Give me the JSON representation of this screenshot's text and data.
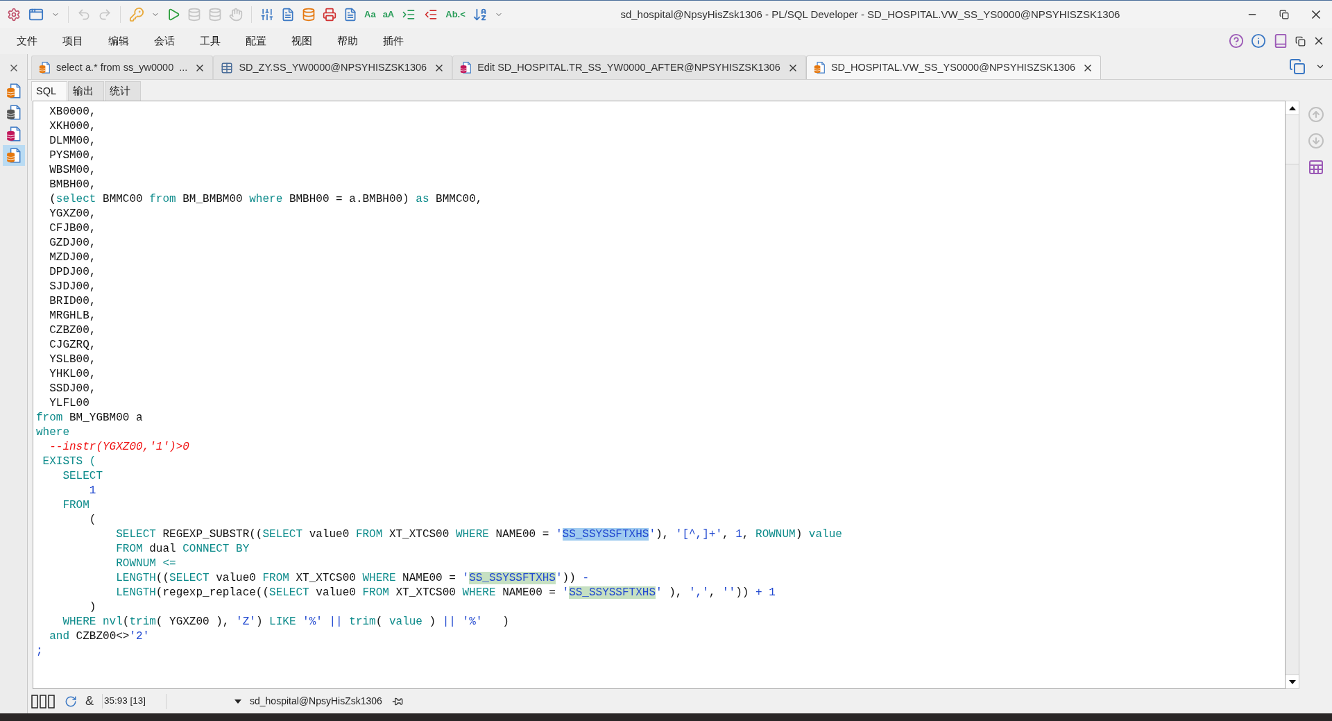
{
  "window": {
    "title": "sd_hospital@NpsyHisZsk1306 - PL/SQL Developer - SD_HOSPITAL.VW_SS_YS0000@NPSYHISZSK1306"
  },
  "toolbar": [
    {
      "kind": "icon",
      "disabled": false
    },
    {
      "kind": "icon",
      "disabled": false
    },
    {
      "kind": "icon",
      "disabled": false
    },
    {
      "kind": "icon",
      "disabled": true
    },
    {
      "kind": "icon",
      "disabled": true
    },
    {
      "kind": "icon",
      "disabled": false
    },
    {
      "kind": "icon",
      "disabled": false
    },
    {
      "kind": "icon",
      "disabled": false
    },
    {
      "kind": "icon",
      "disabled": true
    },
    {
      "kind": "icon",
      "disabled": true
    },
    {
      "kind": "icon",
      "disabled": true
    },
    {
      "kind": "icon",
      "disabled": false
    },
    {
      "kind": "icon",
      "disabled": false
    },
    {
      "kind": "icon",
      "disabled": false
    },
    {
      "kind": "icon",
      "disabled": false
    },
    {
      "kind": "icon",
      "disabled": false
    },
    {
      "kind": "glyph",
      "label": "Aa",
      "disabled": false
    },
    {
      "kind": "glyph",
      "label": "aA",
      "disabled": false
    },
    {
      "kind": "icon",
      "disabled": false
    },
    {
      "kind": "icon",
      "disabled": false
    },
    {
      "kind": "glyph",
      "label": "Ab.<",
      "disabled": false
    },
    {
      "kind": "icon",
      "disabled": false
    },
    {
      "kind": "icon",
      "disabled": false
    }
  ],
  "menu": [
    "文件",
    "项目",
    "编辑",
    "会话",
    "工具",
    "配置",
    "视图",
    "帮助",
    "插件"
  ],
  "windows": [
    {
      "kind": "sql",
      "selected": false
    },
    {
      "kind": "table",
      "selected": false
    },
    {
      "kind": "edit",
      "selected": false
    },
    {
      "kind": "sql",
      "selected": true
    }
  ],
  "tabs": [
    {
      "kind": "sql",
      "label": "select a.* from ss_yw0000  ...",
      "selected": false
    },
    {
      "kind": "table",
      "label": "SD_ZY.SS_YW0000@NPSYHISZSK1306",
      "selected": false
    },
    {
      "kind": "edit",
      "label": "Edit SD_HOSPITAL.TR_SS_YW0000_AFTER@NPSYHISZSK1306",
      "selected": false
    },
    {
      "kind": "sql",
      "label": "SD_HOSPITAL.VW_SS_YS0000@NPSYHISZSK1306",
      "selected": true
    }
  ],
  "sub_tabs": [
    {
      "label": "SQL",
      "selected": true
    },
    {
      "label": "输出",
      "selected": false
    },
    {
      "label": "统计",
      "selected": false
    }
  ],
  "code": [
    {
      "tokens": [
        {
          "kind": "plain",
          "text": "  XB0000,"
        }
      ]
    },
    {
      "tokens": [
        {
          "kind": "plain",
          "text": "  XKH000,"
        }
      ]
    },
    {
      "tokens": [
        {
          "kind": "plain",
          "text": "  DLMM00,"
        }
      ]
    },
    {
      "tokens": [
        {
          "kind": "plain",
          "text": "  PYSM00,"
        }
      ]
    },
    {
      "tokens": [
        {
          "kind": "plain",
          "text": "  WBSM00,"
        }
      ]
    },
    {
      "tokens": [
        {
          "kind": "plain",
          "text": "  BMBH00,"
        }
      ]
    },
    {
      "tokens": [
        {
          "kind": "plain",
          "text": "  ("
        },
        {
          "kind": "kw",
          "text": "select"
        },
        {
          "kind": "plain",
          "text": " BMMC00 "
        },
        {
          "kind": "kw",
          "text": "from"
        },
        {
          "kind": "plain",
          "text": " BM_BMBM00 "
        },
        {
          "kind": "kw",
          "text": "where"
        },
        {
          "kind": "plain",
          "text": " BMBH00 = a.BMBH00) "
        },
        {
          "kind": "kw",
          "text": "as"
        },
        {
          "kind": "plain",
          "text": " BMMC00,"
        }
      ]
    },
    {
      "tokens": [
        {
          "kind": "plain",
          "text": "  YGXZ00,"
        }
      ]
    },
    {
      "tokens": [
        {
          "kind": "plain",
          "text": "  CFJB00,"
        }
      ]
    },
    {
      "tokens": [
        {
          "kind": "plain",
          "text": "  GZDJ00,"
        }
      ]
    },
    {
      "tokens": [
        {
          "kind": "plain",
          "text": "  MZDJ00,"
        }
      ]
    },
    {
      "tokens": [
        {
          "kind": "plain",
          "text": "  DPDJ00,"
        }
      ]
    },
    {
      "tokens": [
        {
          "kind": "plain",
          "text": "  SJDJ00,"
        }
      ]
    },
    {
      "tokens": [
        {
          "kind": "plain",
          "text": "  BRID00,"
        }
      ]
    },
    {
      "tokens": [
        {
          "kind": "plain",
          "text": "  MRGHLB,"
        }
      ]
    },
    {
      "tokens": [
        {
          "kind": "plain",
          "text": "  CZBZ00,"
        }
      ]
    },
    {
      "tokens": [
        {
          "kind": "plain",
          "text": "  CJGZRQ,"
        }
      ]
    },
    {
      "tokens": [
        {
          "kind": "plain",
          "text": "  YSLB00,"
        }
      ]
    },
    {
      "tokens": [
        {
          "kind": "plain",
          "text": "  YHKL00,"
        }
      ]
    },
    {
      "tokens": [
        {
          "kind": "plain",
          "text": "  SSDJ00,"
        }
      ]
    },
    {
      "tokens": [
        {
          "kind": "plain",
          "text": "  YLFL00"
        }
      ]
    },
    {
      "tokens": [
        {
          "kind": "kw",
          "text": "from"
        },
        {
          "kind": "plain",
          "text": " BM_YGBM00 a"
        }
      ]
    },
    {
      "tokens": [
        {
          "kind": "kw",
          "text": "where"
        }
      ]
    },
    {
      "tokens": [
        {
          "kind": "comment",
          "text": "  --instr(YGXZ00,'1')>0"
        }
      ]
    },
    {
      "tokens": [
        {
          "kind": "kw",
          "text": " EXISTS ("
        }
      ]
    },
    {
      "tokens": [
        {
          "kind": "kw",
          "text": "    SELECT"
        }
      ]
    },
    {
      "tokens": [
        {
          "kind": "num",
          "text": "        1"
        }
      ]
    },
    {
      "tokens": [
        {
          "kind": "kw",
          "text": "    FROM"
        }
      ]
    },
    {
      "tokens": [
        {
          "kind": "plain",
          "text": "        ("
        }
      ]
    },
    {
      "tokens": [
        {
          "kind": "kw",
          "text": "            SELECT"
        },
        {
          "kind": "plain",
          "text": " REGEXP_SUBSTR(("
        },
        {
          "kind": "kw",
          "text": "SELECT"
        },
        {
          "kind": "plain",
          "text": " value0 "
        },
        {
          "kind": "kw",
          "text": "FROM"
        },
        {
          "kind": "plain",
          "text": " XT_XTCS00 "
        },
        {
          "kind": "kw",
          "text": "WHERE"
        },
        {
          "kind": "plain",
          "text": " NAME00 = "
        },
        {
          "kind": "str",
          "text": "'"
        },
        {
          "kind": "sel",
          "text": "SS_SSYSSFTXHS"
        },
        {
          "kind": "str",
          "text": "'"
        },
        {
          "kind": "plain",
          "text": "), "
        },
        {
          "kind": "str",
          "text": "'[^,]+'"
        },
        {
          "kind": "plain",
          "text": ", "
        },
        {
          "kind": "num",
          "text": "1"
        },
        {
          "kind": "plain",
          "text": ", "
        },
        {
          "kind": "kw",
          "text": "ROWNUM"
        },
        {
          "kind": "plain",
          "text": ") "
        },
        {
          "kind": "kw",
          "text": "value"
        }
      ]
    },
    {
      "tokens": [
        {
          "kind": "kw",
          "text": "            FROM"
        },
        {
          "kind": "plain",
          "text": " dual "
        },
        {
          "kind": "kw",
          "text": "CONNECT BY"
        }
      ]
    },
    {
      "tokens": [
        {
          "kind": "kw",
          "text": "            ROWNUM <="
        }
      ]
    },
    {
      "tokens": [
        {
          "kind": "kw",
          "text": "            LENGTH"
        },
        {
          "kind": "plain",
          "text": "(("
        },
        {
          "kind": "kw",
          "text": "SELECT"
        },
        {
          "kind": "plain",
          "text": " value0 "
        },
        {
          "kind": "kw",
          "text": "FROM"
        },
        {
          "kind": "plain",
          "text": " XT_XTCS00 "
        },
        {
          "kind": "kw",
          "text": "WHERE"
        },
        {
          "kind": "plain",
          "text": " NAME00 = "
        },
        {
          "kind": "str",
          "text": "'"
        },
        {
          "kind": "match",
          "text": "SS_SSYSSFTXHS"
        },
        {
          "kind": "str",
          "text": "'"
        },
        {
          "kind": "plain",
          "text": ")) "
        },
        {
          "kind": "op",
          "text": "-"
        }
      ]
    },
    {
      "tokens": [
        {
          "kind": "kw",
          "text": "            LENGTH"
        },
        {
          "kind": "plain",
          "text": "(regexp_replace(("
        },
        {
          "kind": "kw",
          "text": "SELECT"
        },
        {
          "kind": "plain",
          "text": " value0 "
        },
        {
          "kind": "kw",
          "text": "FROM"
        },
        {
          "kind": "plain",
          "text": " XT_XTCS00 "
        },
        {
          "kind": "kw",
          "text": "WHERE"
        },
        {
          "kind": "plain",
          "text": " NAME00 = "
        },
        {
          "kind": "str",
          "text": "'"
        },
        {
          "kind": "match",
          "text": "SS_SSYSSFTXHS"
        },
        {
          "kind": "str",
          "text": "'"
        },
        {
          "kind": "plain",
          "text": " ), "
        },
        {
          "kind": "str",
          "text": "','"
        },
        {
          "kind": "plain",
          "text": ", "
        },
        {
          "kind": "str",
          "text": "''"
        },
        {
          "kind": "plain",
          "text": ")) "
        },
        {
          "kind": "op",
          "text": "+ 1"
        }
      ]
    },
    {
      "tokens": [
        {
          "kind": "plain",
          "text": "        )"
        }
      ]
    },
    {
      "tokens": [
        {
          "kind": "kw",
          "text": "    WHERE nvl"
        },
        {
          "kind": "plain",
          "text": "("
        },
        {
          "kind": "kw",
          "text": "trim"
        },
        {
          "kind": "plain",
          "text": "( YGXZ00 ), "
        },
        {
          "kind": "str",
          "text": "'Z'"
        },
        {
          "kind": "plain",
          "text": ") "
        },
        {
          "kind": "kw",
          "text": "LIKE"
        },
        {
          "kind": "str",
          "text": " '%' "
        },
        {
          "kind": "op",
          "text": "||"
        },
        {
          "kind": "kw",
          "text": " trim"
        },
        {
          "kind": "plain",
          "text": "( "
        },
        {
          "kind": "kw",
          "text": "value"
        },
        {
          "kind": "plain",
          "text": " ) "
        },
        {
          "kind": "op",
          "text": "||"
        },
        {
          "kind": "str",
          "text": " '%'"
        },
        {
          "kind": "plain",
          "text": "   )"
        }
      ]
    },
    {
      "tokens": [
        {
          "kind": "kw",
          "text": "  and"
        },
        {
          "kind": "plain",
          "text": " CZBZ00<>"
        },
        {
          "kind": "str",
          "text": "'2'"
        }
      ]
    },
    {
      "tokens": [
        {
          "kind": "op",
          "text": ";"
        }
      ]
    }
  ],
  "status_bar": {
    "glyph": "&",
    "position": "35:93 [13]",
    "connection": "sd_hospital@NpsyHisZsk1306"
  }
}
